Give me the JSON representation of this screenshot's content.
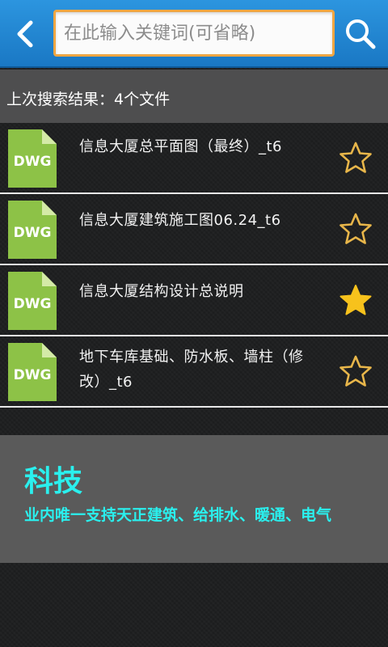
{
  "header": {
    "back_icon": "back-arrow-icon",
    "search_placeholder": "在此输入关键词(可省略)",
    "search_value": "",
    "search_icon": "search-icon"
  },
  "results": {
    "summary": "上次搜索结果：4个文件",
    "files": [
      {
        "name": "信息大厦总平面图（最终）_t6",
        "type": "DWG",
        "starred": false
      },
      {
        "name": "信息大厦建筑施工图06.24_t6",
        "type": "DWG",
        "starred": false
      },
      {
        "name": "信息大厦结构设计总说明",
        "type": "DWG",
        "starred": true
      },
      {
        "name": "地下车库基础、防水板、墙柱（修改）_t6",
        "type": "DWG",
        "starred": false
      }
    ]
  },
  "banner": {
    "title": "科技",
    "subtitle": "业内唯一支持天正建筑、给排水、暖通、电气"
  },
  "colors": {
    "topbar": "#1f86d3",
    "search_border": "#f0a642",
    "star_filled": "#f7c21c",
    "star_outline": "#e8b64a",
    "file_icon": "#8dc247",
    "banner_text": "#2af0ee"
  }
}
